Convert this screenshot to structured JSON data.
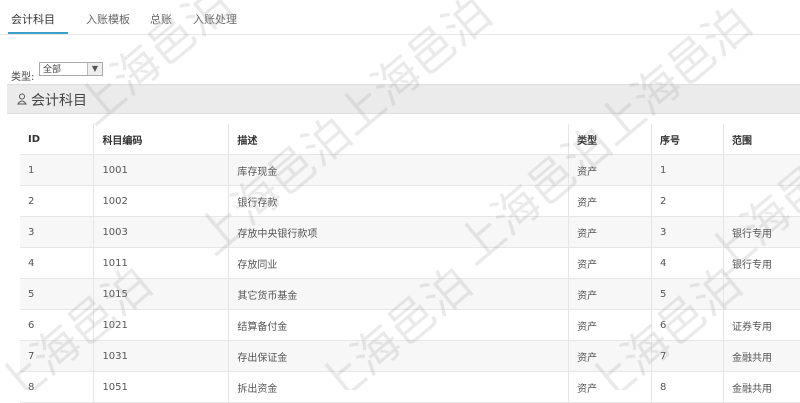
{
  "tabs": [
    {
      "label": "会计科目",
      "active": true
    },
    {
      "label": "入账模板"
    },
    {
      "label": "总账"
    },
    {
      "label": "入账处理"
    }
  ],
  "filter": {
    "label": "类型",
    "value": "全部"
  },
  "panel": {
    "title": "会计科目"
  },
  "table": {
    "columns": [
      "ID",
      "科目编码",
      "描述",
      "类型",
      "序号",
      "范围"
    ],
    "rows": [
      [
        "1",
        "1001",
        "库存现金",
        "资产",
        "1",
        ""
      ],
      [
        "2",
        "1002",
        "银行存款",
        "资产",
        "2",
        ""
      ],
      [
        "3",
        "1003",
        "存放中央银行款项",
        "资产",
        "3",
        "银行专用"
      ],
      [
        "4",
        "1011",
        "存放同业",
        "资产",
        "4",
        "银行专用"
      ],
      [
        "5",
        "1015",
        "其它货币基金",
        "资产",
        "5",
        ""
      ],
      [
        "6",
        "1021",
        "结算备付金",
        "资产",
        "6",
        "证券专用"
      ],
      [
        "7",
        "1031",
        "存出保证金",
        "资产",
        "7",
        "金融共用"
      ],
      [
        "8",
        "1051",
        "拆出资金",
        "资产",
        "8",
        "金融共用"
      ]
    ]
  },
  "watermark": {
    "text": "上海邑泊"
  },
  "colors": {
    "accent": "#3aa0c8",
    "panel_bg": "#ebebeb"
  }
}
